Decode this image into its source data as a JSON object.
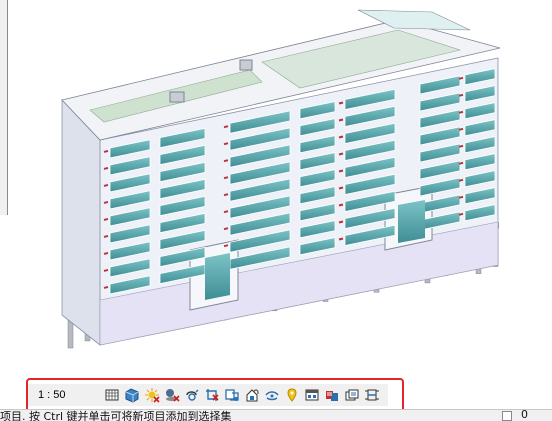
{
  "view_control_bar": {
    "scale": "1 : 50",
    "buttons": [
      {
        "name": "detail-level-icon"
      },
      {
        "name": "visual-style-icon"
      },
      {
        "name": "sun-path-off-icon"
      },
      {
        "name": "shadows-off-icon"
      },
      {
        "name": "rendering-dialog-icon"
      },
      {
        "name": "crop-view-icon"
      },
      {
        "name": "show-crop-region-icon"
      },
      {
        "name": "unlock-3d-view-icon"
      },
      {
        "name": "temporary-hide-isolate-icon"
      },
      {
        "name": "reveal-hidden-elements-icon"
      },
      {
        "name": "temporary-view-properties-icon"
      },
      {
        "name": "worksharing-display-icon"
      },
      {
        "name": "show-analytical-model-icon"
      },
      {
        "name": "highlight-displacement-icon"
      },
      {
        "name": "reveal-constraints-icon"
      }
    ]
  },
  "status_bar": {
    "text": "项目. 按 Ctrl 键并单击可将新项目添加到选择集",
    "right_value": "0"
  },
  "colors": {
    "highlight": "#e0262a",
    "building_wall": "#eef1f8",
    "window_glass": "#4fa8ae",
    "accent_red": "#b8343c",
    "roof_green": "#cfe2d0"
  }
}
